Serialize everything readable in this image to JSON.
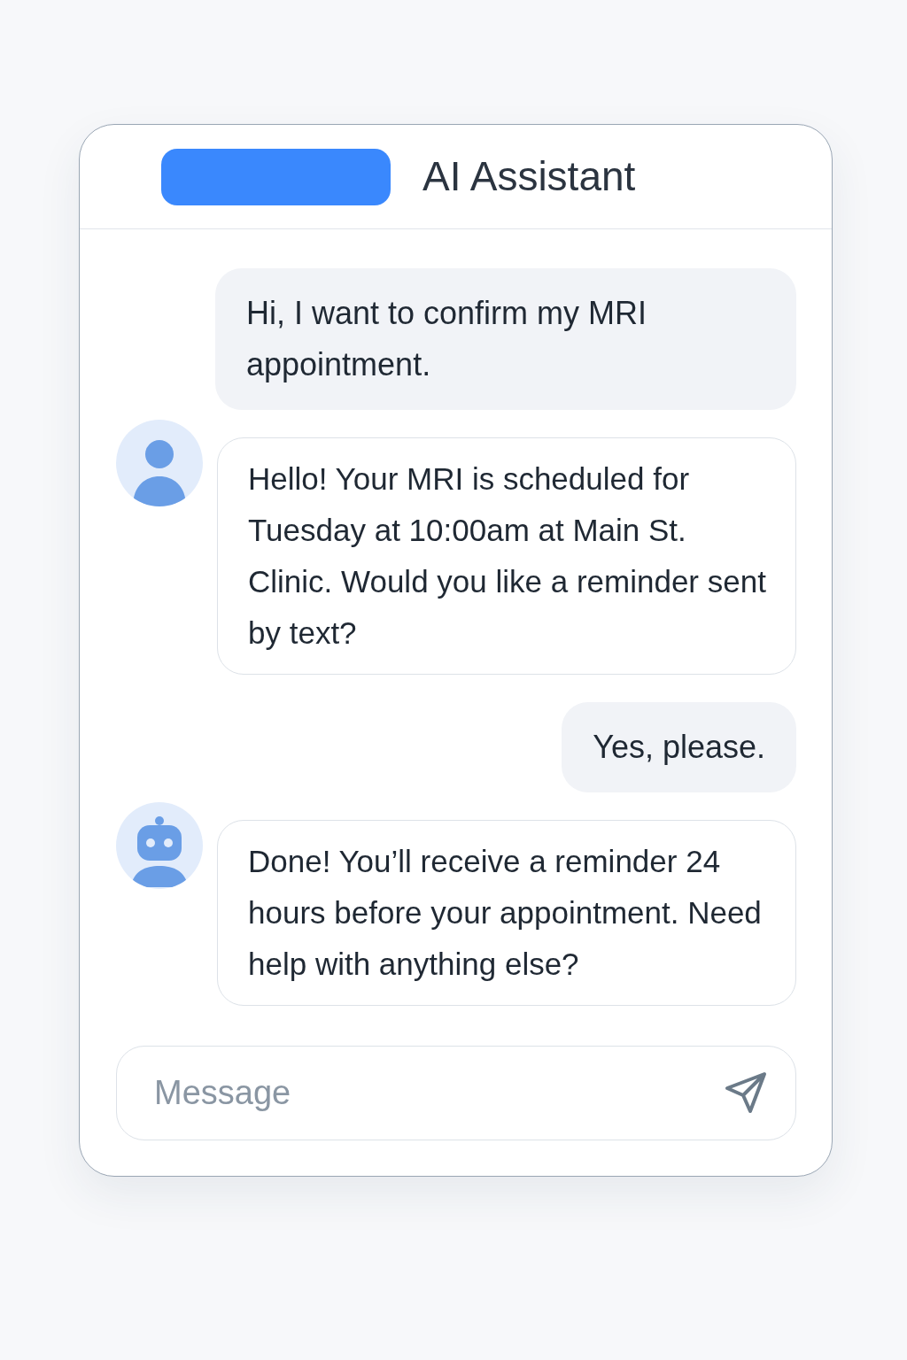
{
  "header": {
    "title": "AI Assistant"
  },
  "messages": [
    {
      "kind": "user",
      "text": "Hi, I want to confirm my MRI appointment."
    },
    {
      "kind": "staff",
      "text": "Hello! Your MRI is scheduled for Tuesday at 10:00am at Main St. Clinic. Would you like a reminder sent by text?"
    },
    {
      "kind": "user",
      "text": "Yes, please."
    },
    {
      "kind": "bot",
      "text": "Done! You’ll receive a reminder 24 hours before your appointment. Need help with anything else?"
    }
  ],
  "composer": {
    "placeholder": "Message"
  }
}
